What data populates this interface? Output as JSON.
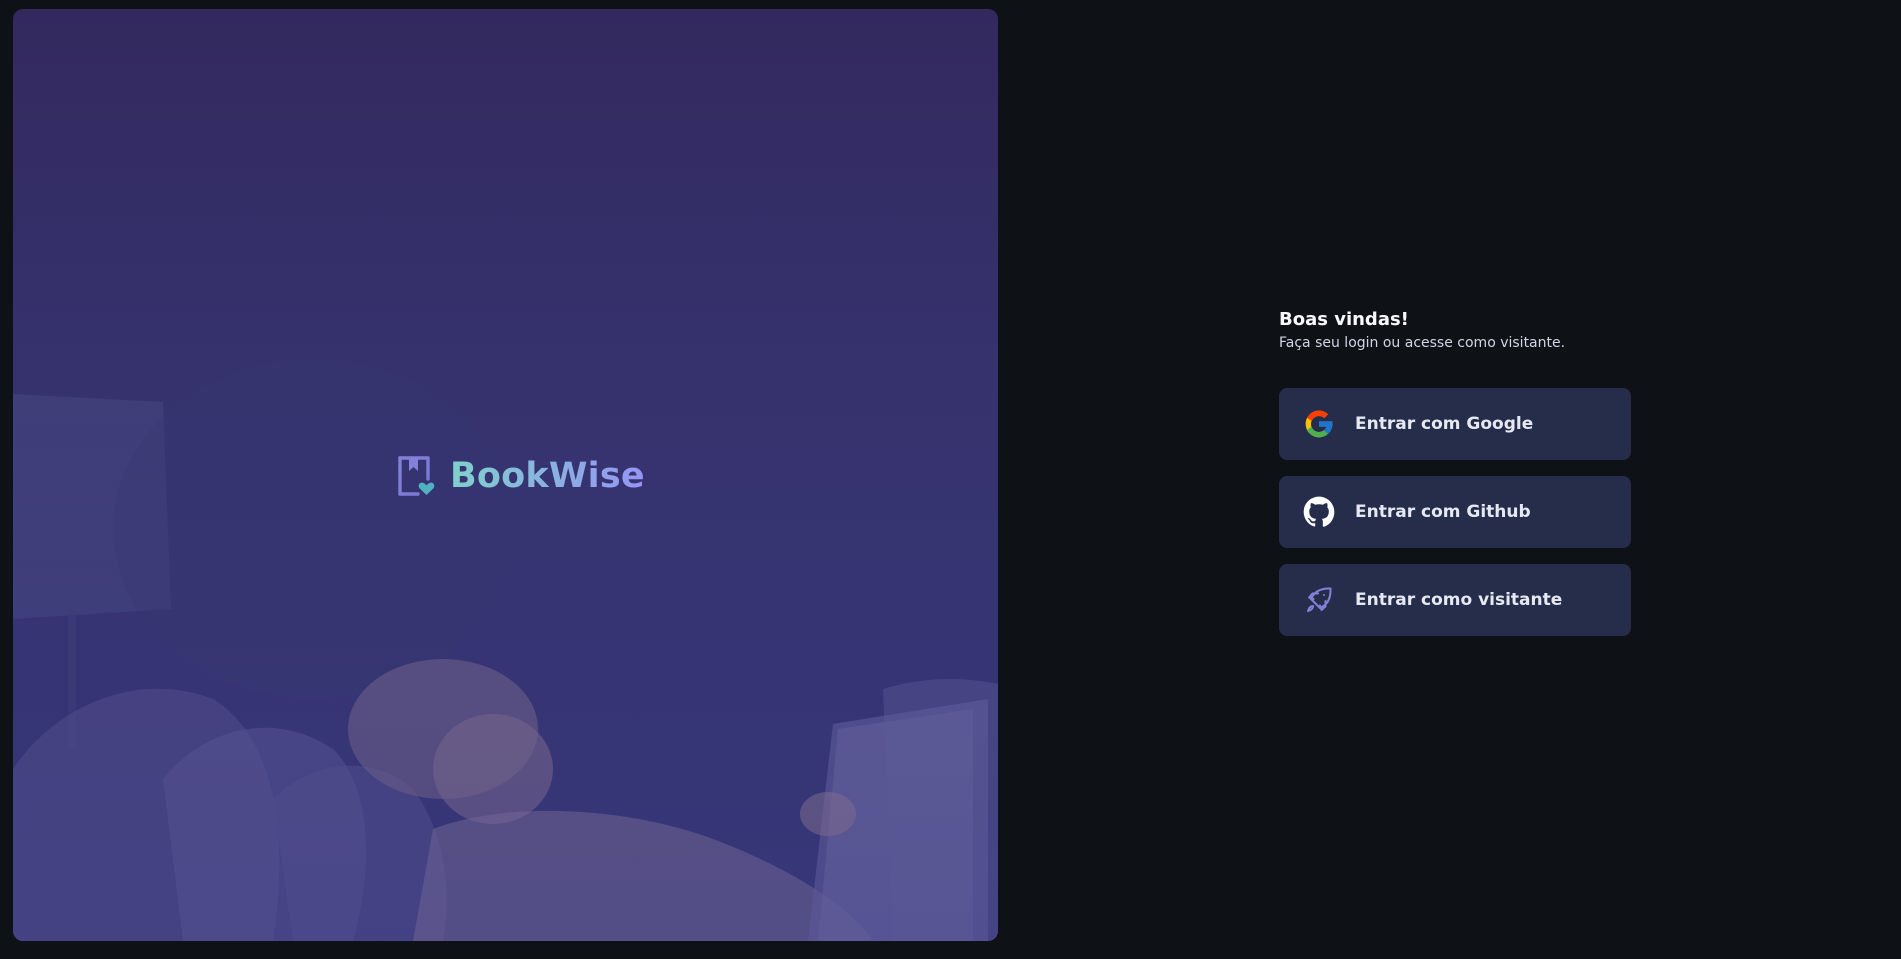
{
  "hero": {
    "brand_name": "BookWise",
    "logo_icon": "book-heart-icon"
  },
  "login": {
    "title": "Boas vindas!",
    "subtitle": "Faça seu login ou acesse como visitante.",
    "buttons": [
      {
        "label": "Entrar com Google",
        "icon": "google-icon"
      },
      {
        "label": "Entrar com Github",
        "icon": "github-icon"
      },
      {
        "label": "Entrar como visitante",
        "icon": "rocket-icon"
      }
    ]
  },
  "colors": {
    "background": "#0e1116",
    "button_bg": "#252d4a",
    "brand_teal": "#7fd1cc",
    "brand_purple": "#8381d9"
  }
}
